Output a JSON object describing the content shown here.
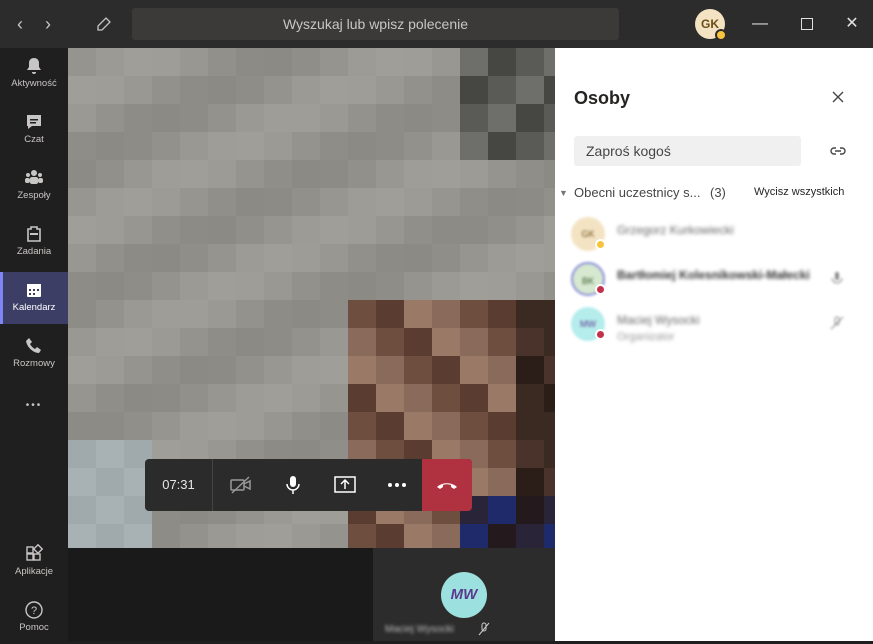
{
  "titlebar": {
    "back_glyph": "‹",
    "forward_glyph": "›",
    "compose_icon": "compose-icon",
    "search_placeholder": "Wyszukaj lub wpisz polecenie",
    "user_initials": "GK",
    "minimize_glyph": "—",
    "close_glyph": "✕"
  },
  "rail": {
    "items": [
      {
        "label": "Aktywność",
        "icon": "bell-icon"
      },
      {
        "label": "Czat",
        "icon": "chat-icon"
      },
      {
        "label": "Zespoły",
        "icon": "teams-icon"
      },
      {
        "label": "Zadania",
        "icon": "bag-icon"
      },
      {
        "label": "Kalendarz",
        "icon": "calendar-icon",
        "active": true
      },
      {
        "label": "Rozmowy",
        "icon": "phone-icon"
      },
      {
        "label": "",
        "icon": "more-icon"
      },
      {
        "label": "Aplikacje",
        "icon": "apps-icon"
      },
      {
        "label": "Pomoc",
        "icon": "help-icon"
      }
    ],
    "more_glyph": "•••"
  },
  "call": {
    "timer": "07:31",
    "tile_initials": "MW",
    "tile_name": "Maciej Wysocki"
  },
  "panel": {
    "title": "Osoby",
    "invite_placeholder": "Zaproś kogoś",
    "section_name": "Obecni uczestnicy s...",
    "section_count": "(3)",
    "mute_all": "Wycisz wszystkich",
    "people": [
      {
        "initials": "GK",
        "name": "Grzegorz Kurkowiecki",
        "role": "",
        "avatar_color": "#f3e3c3",
        "status_color": "#f8c43d"
      },
      {
        "initials": "BK",
        "name": "Bartłomiej Kolesnikowski-Małecki",
        "role": "",
        "avatar_color": "#d6e8d0",
        "status_color": "#c4314b"
      },
      {
        "initials": "MW",
        "name": "Maciej Wysocki",
        "role": "Organizator",
        "avatar_color": "#b5ecec",
        "status_color": "#c4314b"
      }
    ]
  },
  "colors": {
    "accent": "#7f85f5",
    "hangup": "#b03140",
    "rail_active": "#3d3e66"
  }
}
